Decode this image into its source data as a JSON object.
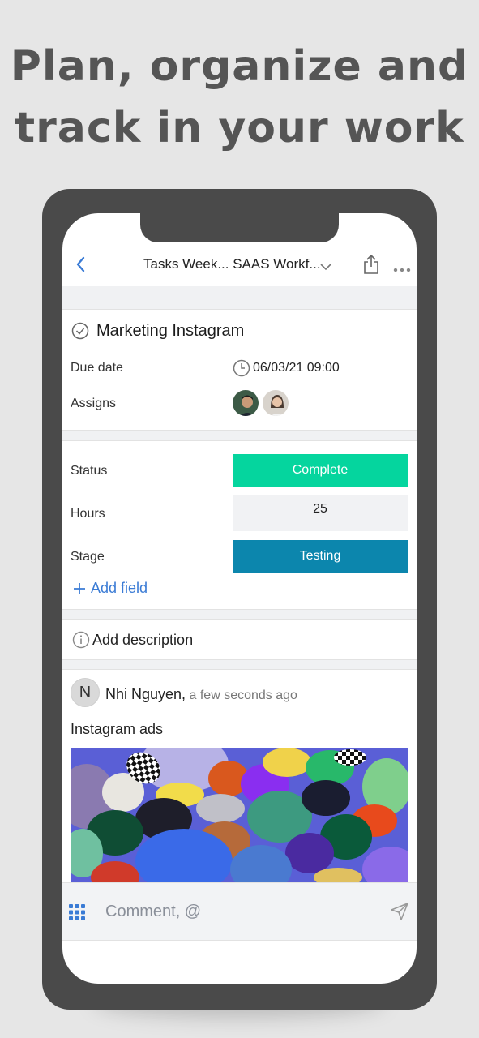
{
  "headline": {
    "line1": "Plan, organize and",
    "line2": "track in your work"
  },
  "nav": {
    "title": "Tasks Week... SAAS Workf...",
    "back_icon": "chevron-left-icon",
    "share_icon": "share-icon",
    "more_icon": "more-dots-icon"
  },
  "task": {
    "title": "Marketing Instagram",
    "due_label": "Due date",
    "due_value": "06/03/21 09:00",
    "assigns_label": "Assigns"
  },
  "fields": {
    "status_label": "Status",
    "status_value": "Complete",
    "hours_label": "Hours",
    "hours_value": "25",
    "stage_label": "Stage",
    "stage_value": "Testing",
    "add_field": "Add field"
  },
  "description": {
    "label": "Add description"
  },
  "comment": {
    "avatar_initial": "N",
    "author": "Nhi Nguyen,",
    "time": "a few seconds ago",
    "text": "Instagram ads"
  },
  "composer": {
    "placeholder": "Comment, @"
  },
  "colors": {
    "status": "#05d59e",
    "stage": "#0c86ad",
    "accent": "#3a7bd5"
  }
}
